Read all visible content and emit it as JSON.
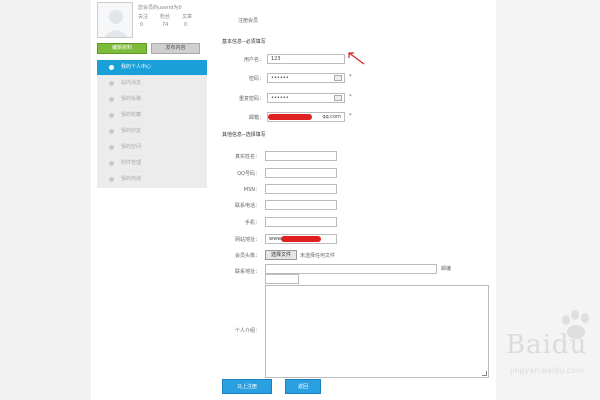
{
  "profile": {
    "name": "您会员的userid为0",
    "stats_labels": [
      "关注",
      "粉丝",
      "文章"
    ],
    "stats_values": [
      "0",
      "74",
      "0"
    ],
    "primary_button": "编辑资料",
    "secondary_button": "发布内容"
  },
  "sidebar": {
    "items": [
      {
        "label": "我的个人中心",
        "active": true
      },
      {
        "label": "站内消息"
      },
      {
        "label": "我的投稿"
      },
      {
        "label": "我的收藏"
      },
      {
        "label": "我的好友"
      },
      {
        "label": "我的空间"
      },
      {
        "label": "附件管理"
      },
      {
        "label": "我的商城"
      }
    ]
  },
  "form": {
    "title": "注册会员",
    "basic_section": "基本信息--必须填写",
    "username_label": "用户名：",
    "username_value": "123",
    "password_label": "密码：",
    "password_value": "••••••",
    "confirm_label": "重复密码：",
    "confirm_value": "••••••",
    "email_label": "邮箱：",
    "email_value": "qq.com",
    "required_mark": "*",
    "other_section": "其他信息--选择填写",
    "fields": [
      {
        "label": "真实姓名："
      },
      {
        "label": "QQ号码："
      },
      {
        "label": "MSN："
      },
      {
        "label": "联系电话："
      },
      {
        "label": "手机："
      },
      {
        "label": "网站地址：",
        "value": "www."
      }
    ],
    "avatar_label": "会员头像：",
    "file_button": "选择文件",
    "file_status": "未选择任何文件",
    "address_label": "联系地址：",
    "address_tip": "邮编",
    "intro_label": "个人介绍：",
    "submit_button": "马上注册",
    "back_button": "返回"
  },
  "watermark": {
    "logo": "Baidu",
    "url": "jingyan.baidu.com"
  },
  "colors": {
    "accent_blue": "#19a0d8",
    "green": "#7dbb3a",
    "redaction": "#e02020"
  }
}
